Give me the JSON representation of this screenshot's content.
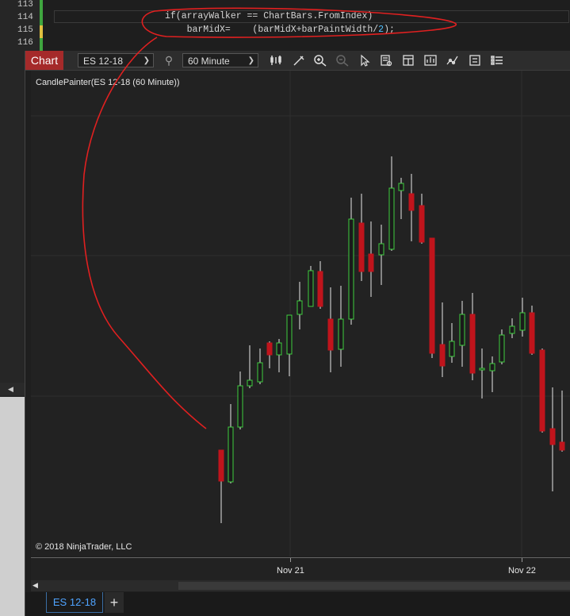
{
  "editor": {
    "lines": [
      {
        "num": "113",
        "code": "",
        "marker": "#3fa63f"
      },
      {
        "num": "114",
        "code_kw": "if(arrayWalker == ChartBars.FromIndex)",
        "marker": "#3fa63f"
      },
      {
        "num": "115",
        "code_a": "    barMidX=    (barMidX+barPaintWidth/",
        "code_num": "2",
        "code_b": ");",
        "marker": "#e0c040"
      },
      {
        "num": "116",
        "code": "",
        "marker": "#3fa63f"
      }
    ]
  },
  "toolbar": {
    "chart_tab": "Chart",
    "instrument": "ES 12-18",
    "period": "60 Minute"
  },
  "plot": {
    "indicator_label": "CandlePainter(ES 12-18 (60 Minute))",
    "copyright": "© 2018 NinjaTrader, LLC"
  },
  "xaxis": {
    "labels": [
      "Nov 21",
      "Nov 22"
    ]
  },
  "bottom": {
    "tab": "ES 12-18",
    "add": "+"
  },
  "colors": {
    "up": "#3fcf3f",
    "down": "#c0141c",
    "wick": "#e8e8e8",
    "annotation": "#e02020",
    "chart_tab": "#a52a2a"
  },
  "chart_data": {
    "type": "candlestick",
    "series": [
      {
        "o": 97.5,
        "h": 97.5,
        "l": 101.6,
        "c": 100.0
      },
      {
        "o": 100.0,
        "h": 94.0,
        "l": 100.2,
        "c": 97.0
      },
      {
        "o": 97.0,
        "h": 92.3,
        "l": 98.0,
        "c": 93.4
      },
      {
        "o": 93.4,
        "h": 91.1,
        "l": 94.8,
        "c": 92.9
      },
      {
        "o": 92.9,
        "h": 91.3,
        "l": 94.0,
        "c": 93.5
      },
      {
        "o": 93.5,
        "h": 91.7,
        "l": 93.5,
        "c": 92.5
      },
      {
        "o": 92.5,
        "h": 90.9,
        "l": 93.2,
        "c": 91.9
      },
      {
        "o": 91.9,
        "h": 91.3,
        "l": 92.8,
        "c": 92.3
      },
      {
        "o": 92.3,
        "h": 90.4,
        "l": 93.2,
        "c": 91.7
      },
      {
        "o": 91.7,
        "h": 90.6,
        "l": 92.9,
        "c": 91.2
      },
      {
        "o": 91.2,
        "h": 89.5,
        "l": 92.3,
        "c": 90.4
      },
      {
        "o": 90.4,
        "h": 88.9,
        "l": 91.1,
        "c": 89.8
      },
      {
        "o": 89.8,
        "h": 88.6,
        "l": 91.0,
        "c": 90.5
      },
      {
        "o": 90.5,
        "h": 88.4,
        "l": 92.2,
        "c": 91.6
      },
      {
        "o": 91.6,
        "h": 90.4,
        "l": 92.2,
        "c": 91.0
      },
      {
        "o": 91.0,
        "h": 89.5,
        "l": 92.2,
        "c": 91.3
      },
      {
        "o": 91.3,
        "h": 88.7,
        "l": 91.8,
        "c": 89.9
      },
      {
        "o": 89.9,
        "h": 88.5,
        "l": 90.9,
        "c": 89.4
      },
      {
        "o": 89.4,
        "h": 88.4,
        "l": 90.5,
        "c": 89.8
      },
      {
        "o": 89.8,
        "h": 88.6,
        "l": 91.0,
        "c": 90.3
      }
    ],
    "note_icon": "",
    "xlabels": [
      "Nov 21",
      "Nov 22"
    ]
  }
}
